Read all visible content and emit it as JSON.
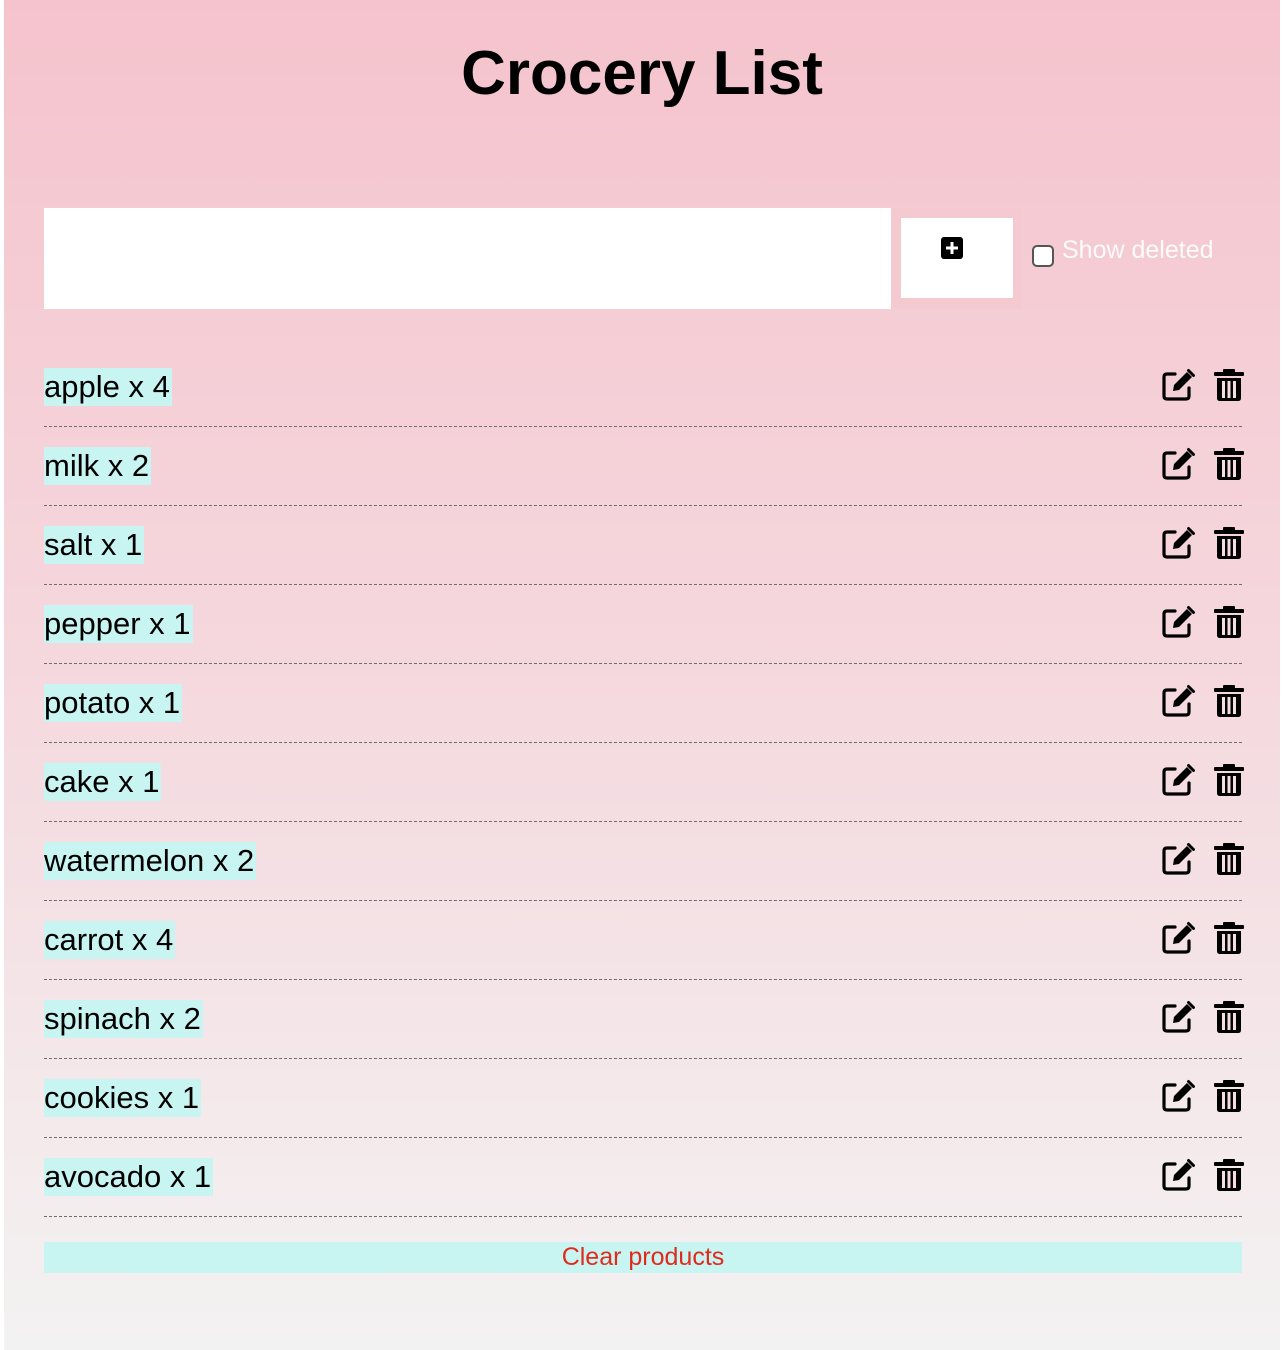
{
  "title": "Crocery List",
  "form": {
    "input_value": "",
    "add_icon": "plus-square-icon",
    "show_deleted_label": "Show deleted",
    "show_deleted_checked": false
  },
  "items": [
    {
      "label": "apple x 4"
    },
    {
      "label": "milk x 2"
    },
    {
      "label": "salt x 1"
    },
    {
      "label": "pepper x 1"
    },
    {
      "label": "potato x 1"
    },
    {
      "label": "cake x 1"
    },
    {
      "label": "watermelon x 2"
    },
    {
      "label": "carrot x 4"
    },
    {
      "label": "spinach x 2"
    },
    {
      "label": "cookies x 1"
    },
    {
      "label": "avocado x 1"
    }
  ],
  "item_icons": {
    "edit": "edit-icon",
    "delete": "trash-icon"
  },
  "clear_label": "Clear products",
  "colors": {
    "background_top": "#f5c3cd",
    "background_bottom": "#f3f2f2",
    "item_highlight": "#c8f4f2",
    "clear_text": "#e02b1c"
  }
}
